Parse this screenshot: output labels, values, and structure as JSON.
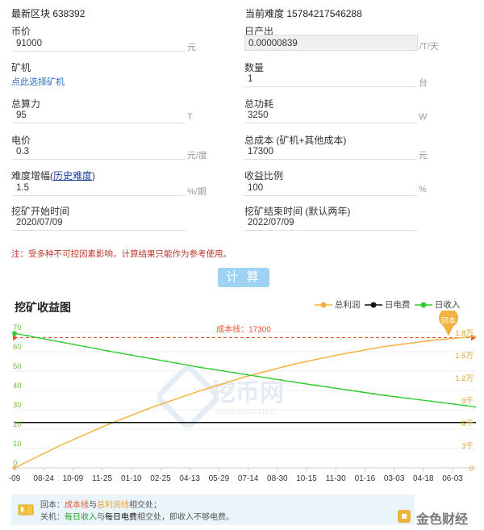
{
  "header": {
    "latest_block_label": "最新区块 638392",
    "difficulty_label": "当前难度 15784217546288"
  },
  "form": {
    "price_label": "币价",
    "price_value": "91000",
    "price_unit": "元",
    "daily_output_label": "日产出",
    "daily_output_value": "0.00000839",
    "daily_output_unit": "/T/天",
    "miner_label": "矿机",
    "miner_link": "点此选择矿机",
    "quantity_label": "数量",
    "quantity_value": "1",
    "quantity_unit": "台",
    "hashrate_label": "总算力",
    "hashrate_value": "95",
    "hashrate_unit": "T",
    "power_label": "总功耗",
    "power_value": "3250",
    "power_unit": "W",
    "elec_label": "电价",
    "elec_value": "0.3",
    "elec_unit": "元/度",
    "total_cost_label": "总成本 (矿机+其他成本)",
    "total_cost_value": "17300",
    "total_cost_unit": "元",
    "diff_growth_label": "难度增幅",
    "diff_history_link": "历史难度",
    "diff_growth_value": "1.5",
    "diff_growth_unit": "%/期",
    "profit_ratio_label": "收益比例",
    "profit_ratio_value": "100",
    "profit_ratio_unit": "%",
    "start_label": "挖矿开始时间",
    "start_value": "2020/07/09",
    "end_label": "挖矿结束时间 (默认两年)",
    "end_value": "2022/07/09"
  },
  "notice": "注：受多种不可控因素影响，计算结果只能作为参考使用。",
  "calc_button": "计 算",
  "chart_title": "挖矿收益图",
  "legend": {
    "profit": "总利润",
    "elec": "日电费",
    "income": "日收入"
  },
  "watermark": {
    "name": "挖币网",
    "url": "www.wabi.com"
  },
  "footer": {
    "payback_prefix": "回本：",
    "payback_a": "成本线",
    "payback_mid": "与",
    "payback_b": "总利润线",
    "payback_suffix": "相交处；",
    "shutdown_prefix": "关机：",
    "shutdown_a": "每日收入",
    "shutdown_mid": "与",
    "shutdown_b": "每日电费",
    "shutdown_suffix": "相交处，即收入不够电费。",
    "brand": "金色财经"
  },
  "colors": {
    "profit": "#f5b13d",
    "elec": "#111111",
    "income": "#33cc33",
    "cost_line": "#e8562a"
  },
  "chart_data": {
    "type": "line",
    "cost_line_label": "成本线：17300",
    "payback_marker": "回本",
    "x_ticks": [
      "-09",
      "08-24",
      "10-09",
      "11-25",
      "01-10",
      "02-25",
      "04-13",
      "05-29",
      "07-14",
      "08-30",
      "10-15",
      "11-30",
      "01-16",
      "03-03",
      "04-18",
      "06-03"
    ],
    "left_axis": {
      "ticks": [
        "0",
        "10",
        "20",
        "30",
        "40",
        "50",
        "60",
        "70"
      ],
      "ylim": [
        0,
        70
      ]
    },
    "right_axis": {
      "ticks": [
        "0",
        "3千",
        "6千",
        "9千",
        "1.2万",
        "1.5万",
        "1.8万"
      ],
      "ylim": [
        0,
        18000
      ]
    },
    "cost_line": 17300,
    "series": [
      {
        "name": "总利润",
        "axis": "right",
        "x": [
          0,
          0.1,
          0.2,
          0.3,
          0.4,
          0.5,
          0.6,
          0.7,
          0.8,
          0.9,
          1.0
        ],
        "values": [
          0,
          3000,
          5700,
          8100,
          10200,
          12100,
          13700,
          15000,
          16100,
          16900,
          17500
        ]
      },
      {
        "name": "日电费",
        "axis": "left",
        "x": [
          0,
          1.0
        ],
        "values": [
          23.4,
          23.4
        ]
      },
      {
        "name": "日收入",
        "axis": "left",
        "x": [
          0,
          0.2,
          0.4,
          0.6,
          0.8,
          1.0
        ],
        "values": [
          69.5,
          60.5,
          52.0,
          44.5,
          37.5,
          31.5
        ]
      }
    ]
  }
}
